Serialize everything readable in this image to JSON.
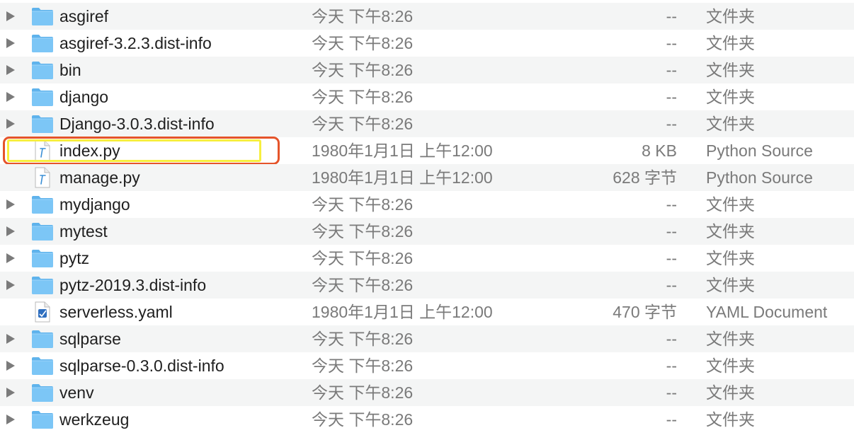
{
  "accent_colors": {
    "outer_highlight": "#e5542a",
    "inner_highlight": "#f7ef3f",
    "folder": "#5fb3ec"
  },
  "files": [
    {
      "name": "asgiref",
      "date": "今天 下午8:26",
      "size": "--",
      "kind": "文件夹",
      "icon": "folder-icon",
      "expandable": true
    },
    {
      "name": "asgiref-3.2.3.dist-info",
      "date": "今天 下午8:26",
      "size": "--",
      "kind": "文件夹",
      "icon": "folder-icon",
      "expandable": true
    },
    {
      "name": "bin",
      "date": "今天 下午8:26",
      "size": "--",
      "kind": "文件夹",
      "icon": "folder-icon",
      "expandable": true
    },
    {
      "name": "django",
      "date": "今天 下午8:26",
      "size": "--",
      "kind": "文件夹",
      "icon": "folder-icon",
      "expandable": true
    },
    {
      "name": "Django-3.0.3.dist-info",
      "date": "今天 下午8:26",
      "size": "--",
      "kind": "文件夹",
      "icon": "folder-icon",
      "expandable": true
    },
    {
      "name": "index.py",
      "date": "1980年1月1日 上午12:00",
      "size": "8 KB",
      "kind": "Python Source",
      "icon": "python-file-icon",
      "expandable": false,
      "highlighted": true
    },
    {
      "name": "manage.py",
      "date": "1980年1月1日 上午12:00",
      "size": "628 字节",
      "kind": "Python Source",
      "icon": "python-file-icon",
      "expandable": false
    },
    {
      "name": "mydjango",
      "date": "今天 下午8:26",
      "size": "--",
      "kind": "文件夹",
      "icon": "folder-icon",
      "expandable": true
    },
    {
      "name": "mytest",
      "date": "今天 下午8:26",
      "size": "--",
      "kind": "文件夹",
      "icon": "folder-icon",
      "expandable": true
    },
    {
      "name": "pytz",
      "date": "今天 下午8:26",
      "size": "--",
      "kind": "文件夹",
      "icon": "folder-icon",
      "expandable": true
    },
    {
      "name": "pytz-2019.3.dist-info",
      "date": "今天 下午8:26",
      "size": "--",
      "kind": "文件夹",
      "icon": "folder-icon",
      "expandable": true
    },
    {
      "name": "serverless.yaml",
      "date": "1980年1月1日 上午12:00",
      "size": "470 字节",
      "kind": "YAML Document",
      "icon": "yaml-file-icon",
      "expandable": false
    },
    {
      "name": "sqlparse",
      "date": "今天 下午8:26",
      "size": "--",
      "kind": "文件夹",
      "icon": "folder-icon",
      "expandable": true
    },
    {
      "name": "sqlparse-0.3.0.dist-info",
      "date": "今天 下午8:26",
      "size": "--",
      "kind": "文件夹",
      "icon": "folder-icon",
      "expandable": true
    },
    {
      "name": "venv",
      "date": "今天 下午8:26",
      "size": "--",
      "kind": "文件夹",
      "icon": "folder-icon",
      "expandable": true
    },
    {
      "name": "werkzeug",
      "date": "今天 下午8:26",
      "size": "--",
      "kind": "文件夹",
      "icon": "folder-icon",
      "expandable": true
    }
  ]
}
